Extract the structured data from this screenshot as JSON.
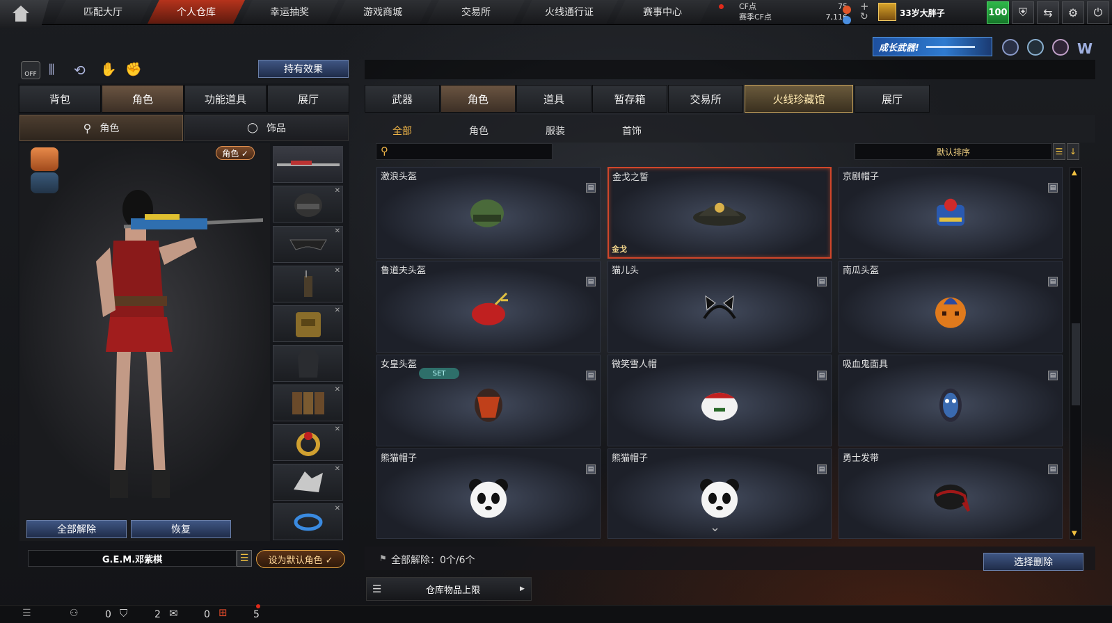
{
  "topnav": {
    "tabs": [
      "匹配大厅",
      "个人仓库",
      "幸运抽奖",
      "游戏商城",
      "交易所",
      "火线通行证",
      "赛事中心"
    ],
    "active_index": 1
  },
  "currency": {
    "cf_label": "CF点",
    "cf_value": "75",
    "season_label": "赛季CF点",
    "season_value": "7,116",
    "plus": "+",
    "refresh": "↻"
  },
  "user": {
    "name": "33岁大胖子",
    "level": "100"
  },
  "banner": {
    "text": "成长武器!"
  },
  "left": {
    "effect_button": "持有效果",
    "off_label": "OFF",
    "tabs": [
      "背包",
      "角色",
      "功能道具",
      "展厅"
    ],
    "active_tab": 1,
    "subtabs": [
      "角色",
      "饰品"
    ],
    "role_badge": "角色 ✓",
    "unequip_all": "全部解除",
    "restore": "恢复",
    "character_name": "G.E.M.邓紫棋",
    "set_default": "设为默认角色 ✓"
  },
  "right": {
    "tabs": [
      "武器",
      "角色",
      "道具",
      "暂存箱",
      "交易所",
      "火线珍藏馆",
      "展厅"
    ],
    "active_tab": 1,
    "highlight_tab": 5,
    "subtabs": [
      "全部",
      "角色",
      "服装",
      "首饰"
    ],
    "active_subtab": 0,
    "search_placeholder": "",
    "sort_label": "默认排序",
    "items": [
      {
        "name": "激浪头盔",
        "icon": "helmet-icon",
        "tag": "",
        "set": ""
      },
      {
        "name": "金戈之誓",
        "icon": "officer-cap-icon",
        "tag": "金戈",
        "set": "",
        "selected": true
      },
      {
        "name": "京剧帽子",
        "icon": "opera-hat-icon",
        "tag": "",
        "set": ""
      },
      {
        "name": "鲁道夫头盔",
        "icon": "reindeer-helmet-icon",
        "tag": "",
        "set": ""
      },
      {
        "name": "猫儿头",
        "icon": "cat-ears-icon",
        "tag": "",
        "set": ""
      },
      {
        "name": "南瓜头盔",
        "icon": "pumpkin-icon",
        "tag": "",
        "set": ""
      },
      {
        "name": "女皇头盔",
        "icon": "queen-helmet-icon",
        "tag": "",
        "set": "SET"
      },
      {
        "name": "微笑雪人帽",
        "icon": "snowman-hat-icon",
        "tag": "",
        "set": ""
      },
      {
        "name": "吸血鬼面具",
        "icon": "vampire-mask-icon",
        "tag": "",
        "set": ""
      },
      {
        "name": "熊猫帽子",
        "icon": "panda-hat-icon",
        "tag": "",
        "set": ""
      },
      {
        "name": "熊猫帽子",
        "icon": "panda-hat-icon",
        "tag": "",
        "set": ""
      },
      {
        "name": "勇士发带",
        "icon": "headband-icon",
        "tag": "",
        "set": ""
      }
    ],
    "unequip_status": "全部解除：0个/6个",
    "select_delete": "选择删除",
    "warehouse_limit": "仓库物品上限"
  },
  "statusbar": {
    "counts": [
      "0",
      "2",
      "0",
      "5"
    ]
  },
  "colors": {
    "accent_red": "#b5331c",
    "gold": "#f0b547",
    "level_green": "#2fb74a"
  }
}
